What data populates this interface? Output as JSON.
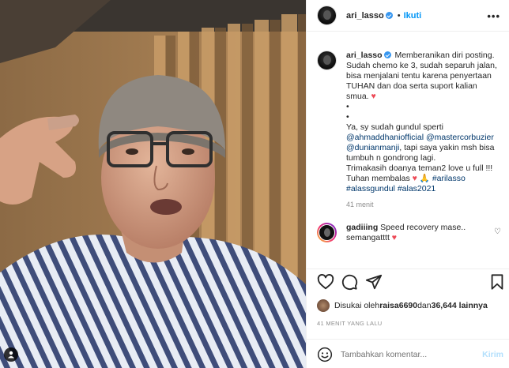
{
  "post": {
    "username": "ari_lasso",
    "follow_label": "Ikuti",
    "more_label": "•••"
  },
  "caption": {
    "username": "ari_lasso",
    "line1": " Memberanikan diri posting. Sudah chemo ke 3, sudah separuh jalan, bisa menjalani tentu karena penyertaan TUHAN dan doa serta suport kalian smua. ",
    "bullet1": "•",
    "bullet2": "•",
    "line2a": "Ya, sy sudah gundul sperti ",
    "mention1": "@ahmaddhaniofficial",
    "mention2": "@mastercorbuzier",
    "mention3": "@dunianmanji",
    "line2b": ", tapi saya yakin msh bisa tumbuh n gondrong lagi.",
    "line3": "Trimakasih doanya teman2 love u full !!!",
    "line4": "Tuhan membalas ",
    "tag1": "#arilasso",
    "tag2": "#alassgundul",
    "tag3": "#alas2021",
    "time": "41 menit"
  },
  "comment": {
    "username": "gadiiing",
    "text": " Speed recovery mase.. semangatttt "
  },
  "likes": {
    "prefix": "Disukai oleh ",
    "user": "raisa6690",
    "middle": " dan ",
    "count": "36,644 lainnya"
  },
  "time_ago": "41 MENIT YANG LALU",
  "add_comment": {
    "placeholder": "Tambahkan komentar...",
    "send_label": "Kirim"
  },
  "icons": [
    "heart-icon",
    "comment-icon",
    "share-icon",
    "bookmark-icon",
    "emoji-icon",
    "verified-icon",
    "more-icon",
    "user-icon"
  ],
  "colors": {
    "accent": "#0095f6",
    "link": "#00376b",
    "heart": "#ed4956",
    "muted": "#8e8e8e"
  }
}
